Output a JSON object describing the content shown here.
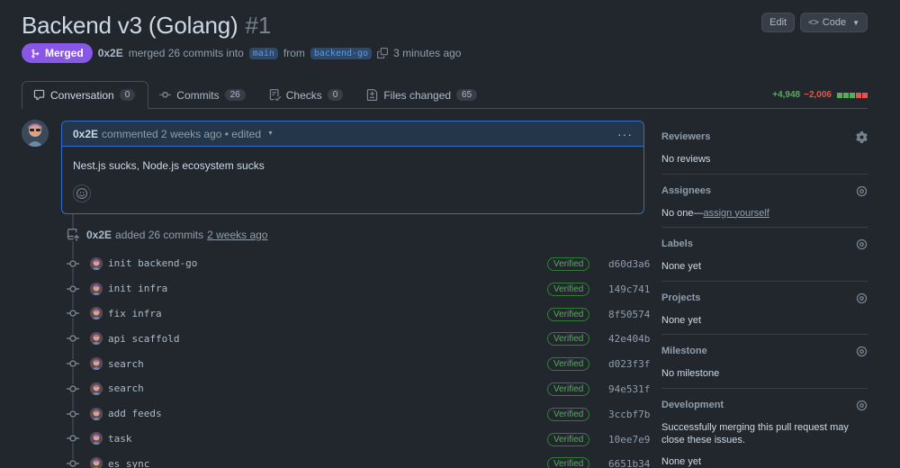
{
  "header": {
    "title": "Backend v3 (Golang)",
    "number": "#1",
    "edit_label": "Edit",
    "code_label": "Code"
  },
  "meta": {
    "status": "Merged",
    "author": "0x2E",
    "merged_text": "merged 26 commits into",
    "base_branch": "main",
    "from_text": "from",
    "head_branch": "backend-go",
    "time": "3 minutes ago"
  },
  "tabs": [
    {
      "label": "Conversation",
      "count": "0"
    },
    {
      "label": "Commits",
      "count": "26"
    },
    {
      "label": "Checks",
      "count": "0"
    },
    {
      "label": "Files changed",
      "count": "65"
    }
  ],
  "diffstat": {
    "additions": "+4,948",
    "deletions": "−2,006",
    "colors": [
      "#57ab5a",
      "#57ab5a",
      "#57ab5a",
      "#e5534b",
      "#e5534b"
    ]
  },
  "comment": {
    "author": "0x2E",
    "meta": "commented 2 weeks ago • edited",
    "body": "Nest.js sucks, Node.js ecosystem sucks"
  },
  "commits_event": {
    "author": "0x2E",
    "text": "added 26 commits",
    "time": "2 weeks ago"
  },
  "commits": [
    {
      "message": "init backend-go",
      "badge": "Verified",
      "sha": "d60d3a6"
    },
    {
      "message": "init infra",
      "badge": "Verified",
      "sha": "149c741"
    },
    {
      "message": "fix infra",
      "badge": "Verified",
      "sha": "8f50574"
    },
    {
      "message": "api scaffold",
      "badge": "Verified",
      "sha": "42e404b"
    },
    {
      "message": "search",
      "badge": "Verified",
      "sha": "d023f3f"
    },
    {
      "message": "search",
      "badge": "Verified",
      "sha": "94e531f"
    },
    {
      "message": "add feeds",
      "badge": "Verified",
      "sha": "3ccbf7b"
    },
    {
      "message": "task",
      "badge": "Verified",
      "sha": "10ee7e9"
    },
    {
      "message": "es sync",
      "badge": "Verified",
      "sha": "6651b34"
    }
  ],
  "sidebar": {
    "reviewers": {
      "title": "Reviewers",
      "value": "No reviews"
    },
    "assignees": {
      "title": "Assignees",
      "prefix": "No one—",
      "link": "assign yourself"
    },
    "labels": {
      "title": "Labels",
      "value": "None yet"
    },
    "projects": {
      "title": "Projects",
      "value": "None yet"
    },
    "milestone": {
      "title": "Milestone",
      "value": "No milestone"
    },
    "development": {
      "title": "Development",
      "text": "Successfully merging this pull request may close these issues.",
      "value": "None yet"
    }
  }
}
